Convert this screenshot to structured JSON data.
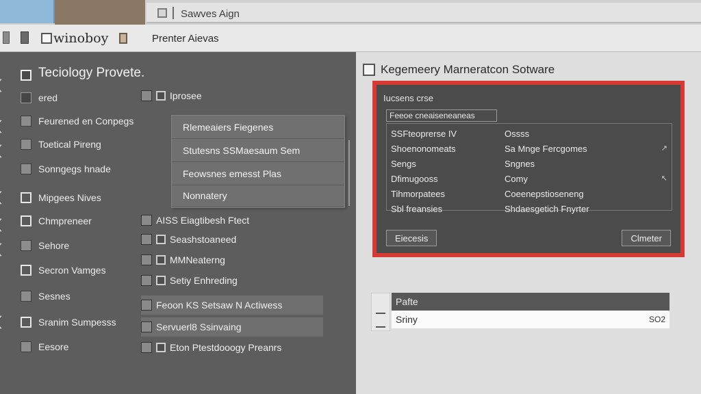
{
  "window": {
    "tab_title": "Sawves Aign"
  },
  "toolbar": {
    "window_label": "winoboy",
    "menu_label": "Prenter Aievas"
  },
  "sidebar": {
    "title": "Teciology Provete.",
    "items": [
      {
        "label": "ered"
      },
      {
        "label": "Feurened en Conpegs"
      },
      {
        "label": "Toetical Pireng"
      },
      {
        "label": "Sonngegs hnade"
      },
      {
        "label": "Mipgees Nives"
      },
      {
        "label": "Chmpreneer"
      },
      {
        "label": "Sehore"
      },
      {
        "label": "Secron Vamges"
      },
      {
        "label": "Sesnes"
      },
      {
        "label": "Sranim Sumpesss"
      },
      {
        "label": "Eesore"
      }
    ]
  },
  "middle": {
    "items": [
      {
        "label": "Iprosee"
      },
      {
        "label": "AISS Eiagtibesh Ftect"
      },
      {
        "label": "Seashstoaneed"
      },
      {
        "label": "MMNeaterng"
      },
      {
        "label": "Setiy Enhreding"
      },
      {
        "label": "Feoon KS Setsaw N Actiwess"
      },
      {
        "label": "Servuerl8 Ssinvaing"
      },
      {
        "label": "Eton Ptestdooogy Preanrs"
      }
    ]
  },
  "popup": {
    "items": [
      {
        "label": "Rlemeaiers Fiegenes"
      },
      {
        "label": "Stutesns SSMaesaum Sem"
      },
      {
        "label": "Feowsnes emesst Plas"
      },
      {
        "label": "Nonnatery"
      }
    ]
  },
  "right": {
    "header_title": "Kegemeery Marneratcon Sotware",
    "dialog": {
      "title": "Iucsens crse",
      "field": "Feeoe cneaiseneaneas",
      "rows": [
        {
          "c1": "SSFteoprerse IV",
          "c2": "Ossss",
          "c3": ""
        },
        {
          "c1": "Shoenonomeats",
          "c2": "Sa Mnge Fercgomes",
          "c3": ""
        },
        {
          "c1": "Sengs",
          "c2": "Sngnes",
          "c3": ""
        },
        {
          "c1": "Dfimugooss",
          "c2": "Comy",
          "c3": ""
        },
        {
          "c1": "Tihmorpatees",
          "c2": "Coeenepstioseneng",
          "c3": ""
        },
        {
          "c1": "Sbl freansies",
          "c2": "Shdaesgetich Fnyrter",
          "c3": ""
        }
      ],
      "button_left": "Eiecesis",
      "button_right": "Clmeter"
    },
    "list": {
      "row1": "Pafte",
      "row2": "Sriny",
      "row2_value": "SO2"
    }
  }
}
